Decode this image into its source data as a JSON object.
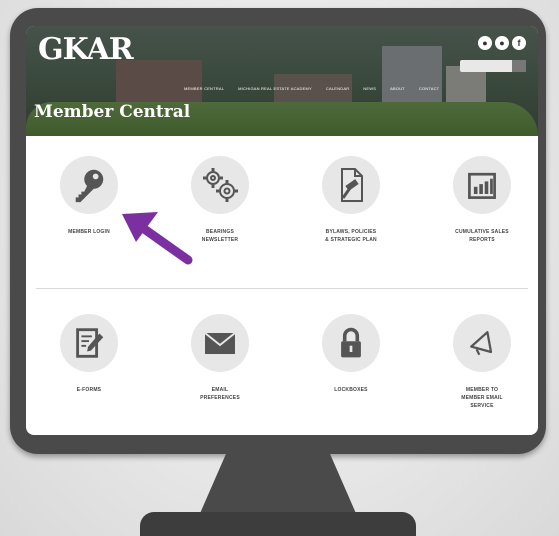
{
  "header": {
    "logo": "GKAR",
    "page_title": "Member Central",
    "nav": [
      "MEMBER CENTRAL",
      "MICHIGAN REAL ESTATE ACADEMY",
      "CALENDAR",
      "NEWS",
      "ABOUT",
      "CONTACT"
    ],
    "social": [
      {
        "icon": "social-icon",
        "glyph": "●"
      },
      {
        "icon": "social-icon",
        "glyph": "●"
      },
      {
        "icon": "facebook-icon",
        "glyph": "f"
      }
    ]
  },
  "tiles": [
    {
      "label": "MEMBER LOGIN",
      "icon": "key-icon"
    },
    {
      "label": "BEARINGS\nNEWSLETTER",
      "icon": "gears-icon"
    },
    {
      "label": "BYLAWS, POLICIES\n& STRATEGIC PLAN",
      "icon": "document-gavel-icon"
    },
    {
      "label": "CUMULATIVE SALES\nREPORTS",
      "icon": "bar-chart-icon"
    },
    {
      "label": "E-FORMS",
      "icon": "form-edit-icon"
    },
    {
      "label": "EMAIL\nPREFERENCES",
      "icon": "envelope-icon"
    },
    {
      "label": "LOCKBOXES",
      "icon": "lock-icon"
    },
    {
      "label": "MEMBER TO\nMEMBER EMAIL\nSERVICE",
      "icon": "megaphone-icon"
    }
  ],
  "annotation": {
    "arrow_color": "#7b2fa0"
  },
  "colors": {
    "monitor": "#4a4a4a",
    "icon": "#555555",
    "circle": "#e7e7e7"
  }
}
